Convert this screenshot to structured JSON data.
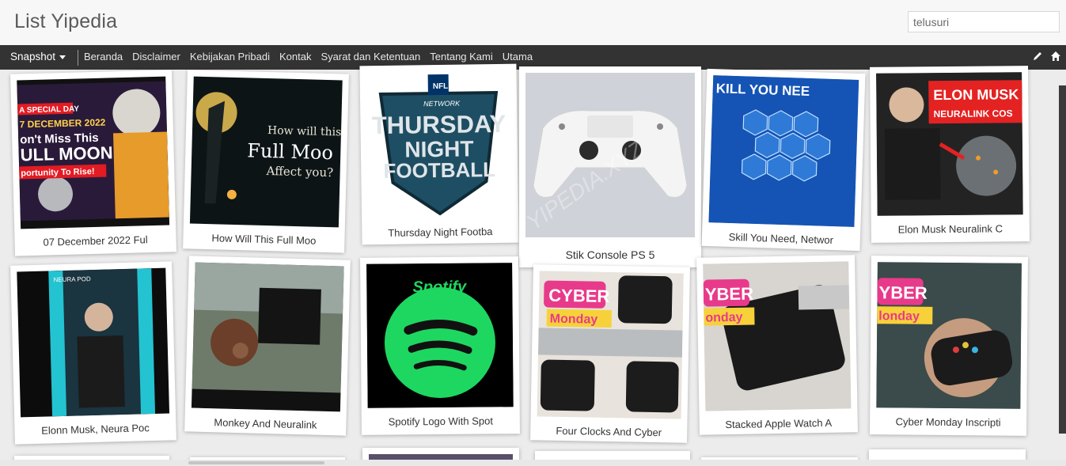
{
  "header": {
    "title": "List Yipedia",
    "search_placeholder": "telusuri"
  },
  "nav": {
    "brand": "Snapshot",
    "links": [
      "Beranda",
      "Disclaimer",
      "Kebijakan Pribadi",
      "Kontak",
      "Syarat dan Ketentuan",
      "Tentang Kami",
      "Utama"
    ],
    "icons": [
      "pencil-icon",
      "home-icon"
    ]
  },
  "cards": [
    {
      "caption": "07 December 2022 Ful",
      "img_text": [
        "A SPECIAL DAY",
        "7 DECEMBER 2022",
        "on't Miss This",
        "ULL MOON",
        "portunity To Rise!"
      ]
    },
    {
      "caption": "How Will This Full Moo",
      "img_text": [
        "How will this",
        "Full Moo",
        "Affect you?"
      ]
    },
    {
      "caption": "Thursday Night Footba",
      "img_text": [
        "NFL",
        "NETWORK",
        "THURSDAY",
        "NIGHT",
        "FOOTBALL"
      ]
    },
    {
      "caption": "Stik Console PS 5"
    },
    {
      "caption": "Skill You Need, Networ",
      "img_text": [
        "KILL YOU NEE"
      ]
    },
    {
      "caption": "Elon Musk Neuralink C",
      "img_text": [
        "ELON MUSK",
        "NEURALINK COS"
      ]
    },
    {
      "caption": "Elonn Musk, Neura Poc",
      "img_text": [
        "NEURA POD"
      ]
    },
    {
      "caption": "Monkey And Neuralink"
    },
    {
      "caption": "Spotify Logo With Spot",
      "img_text": [
        "Spotify"
      ]
    },
    {
      "caption": "Four Clocks And Cyber",
      "img_text": [
        "CYBER",
        "Monday"
      ]
    },
    {
      "caption": "Stacked Apple Watch A",
      "img_text": [
        "YBER",
        "onday"
      ]
    },
    {
      "caption": "Cyber Monday Inscripti",
      "img_text": [
        "YBER",
        "londay"
      ]
    }
  ],
  "watermark": "YIPEDIA.XYZ",
  "colors": {
    "navbar": "#333333",
    "header": "#f7f7f7",
    "page": "#ececec"
  }
}
